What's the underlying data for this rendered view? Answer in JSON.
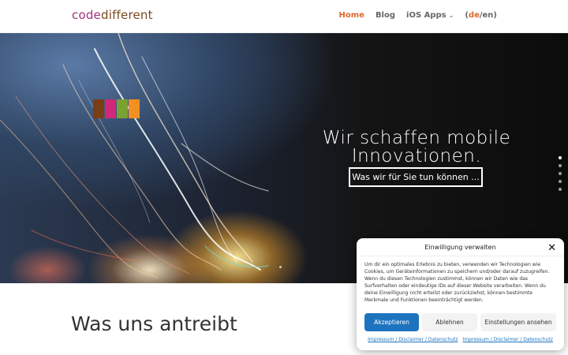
{
  "header": {
    "logo_part1": "code",
    "logo_part2": "different",
    "nav": [
      {
        "label": "Home"
      },
      {
        "label": "Blog"
      },
      {
        "label": "iOS Apps"
      }
    ],
    "lang_open": "(",
    "lang_de": "de",
    "lang_sep": "/en)"
  },
  "hero": {
    "title": "Wir schaffen mobile Innovationen.",
    "button_label": "Was wir für Sie tun können ...",
    "swatch_colors": [
      "#7a3e14",
      "#d0287a",
      "#7aa232",
      "#f39021"
    ],
    "slides": 5,
    "active_slide": 1
  },
  "section": {
    "title": "Was uns antreibt"
  },
  "consent": {
    "title": "Einwilligung verwalten",
    "close_icon": "close-icon",
    "text": "Um dir ein optimales Erlebnis zu bieten, verwenden wir Technologien wie Cookies, um Geräteinformationen zu speichern und/oder darauf zuzugreifen. Wenn du diesen Technologien zustimmst, können wir Daten wie das Surfverhalten oder eindeutige IDs auf dieser Website verarbeiten. Wenn du deine Einwilligung nicht erteilst oder zurückziehst, können bestimmte Merkmale und Funktionen beeinträchtigt werden.",
    "accept_label": "Akzeptieren",
    "deny_label": "Ablehnen",
    "settings_label": "Einstellungen ansehen",
    "link1": "Impressum / Disclaimer / Datenschutz",
    "link2": "Impressum / Disclaimer / Datenschutz",
    "accent": "#1e73be"
  }
}
